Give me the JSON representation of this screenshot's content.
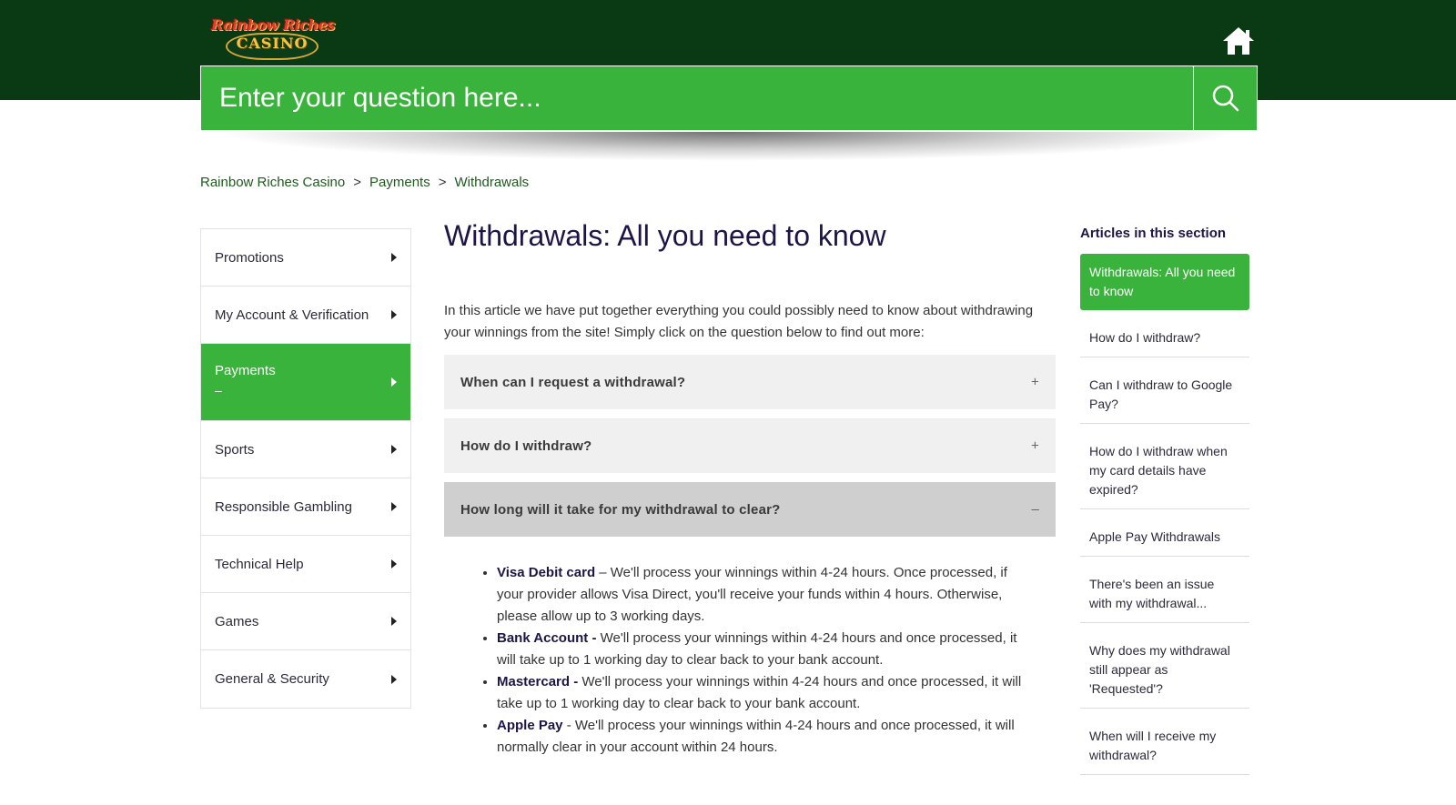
{
  "header": {
    "logo": {
      "line1": "Rainbow Riches",
      "line2": "CASINO"
    },
    "home_icon": "home-icon",
    "search_placeholder": "Enter your question here...",
    "search_icon": "search-icon"
  },
  "colors": {
    "topbar": "#0a3a14",
    "accent_green": "#39b33b",
    "title": "#1e1446",
    "link": "#1e5a1e"
  },
  "breadcrumb": [
    "Rainbow Riches Casino",
    "Payments",
    "Withdrawals"
  ],
  "breadcrumb_separator": ">",
  "nav": {
    "items": [
      {
        "label": "Promotions"
      },
      {
        "label": "My Account & Verification"
      },
      {
        "label": "Payments",
        "active": true,
        "sub": "–"
      },
      {
        "label": "Sports"
      },
      {
        "label": "Responsible Gambling"
      },
      {
        "label": "Technical Help"
      },
      {
        "label": "Games"
      },
      {
        "label": "General & Security"
      }
    ]
  },
  "article": {
    "title": "Withdrawals: All you need to know",
    "intro": "In this article we have put together everything you could possibly need to know about withdrawing your winnings from the site! Simply click on the question below to find out more:",
    "accordions": [
      {
        "title": "When can I request a withdrawal?",
        "sign": "+",
        "open": false
      },
      {
        "title": "How do I withdraw?",
        "sign": "+",
        "open": false
      },
      {
        "title": "How long will it take for my withdrawal to clear?",
        "sign": "–",
        "open": true
      }
    ],
    "bullets": [
      {
        "bold": "Visa Debit card",
        "text": " – We'll process your winnings within 4-24 hours. Once processed, if your provider allows Visa Direct, you'll receive your funds within 4 hours. Otherwise, please allow up to 3 working days."
      },
      {
        "bold": "Bank Account -",
        "text": " We'll process your winnings within 4-24 hours and once processed, it will take up to 1 working day to clear back to your bank account."
      },
      {
        "bold": "Mastercard -",
        "text": " We'll process your winnings within 4-24 hours and once processed, it will take up to 1 working day to clear back to your bank account."
      },
      {
        "bold": "Apple Pay",
        "text": " - We'll process your winnings within 4-24 hours and once processed, it will normally clear in your account within 24 hours."
      }
    ]
  },
  "sidebar": {
    "heading": "Articles in this section",
    "links": [
      {
        "label": "Withdrawals: All you need to know",
        "active": true
      },
      {
        "label": "How do I withdraw?"
      },
      {
        "label": "Can I withdraw to Google Pay?"
      },
      {
        "label": "How do I withdraw when my card details have expired?"
      },
      {
        "label": "Apple Pay Withdrawals"
      },
      {
        "label": "There's been an issue with my withdrawal..."
      },
      {
        "label": "Why does my withdrawal still appear as 'Requested'?"
      },
      {
        "label": "When will I receive my withdrawal?"
      }
    ]
  }
}
